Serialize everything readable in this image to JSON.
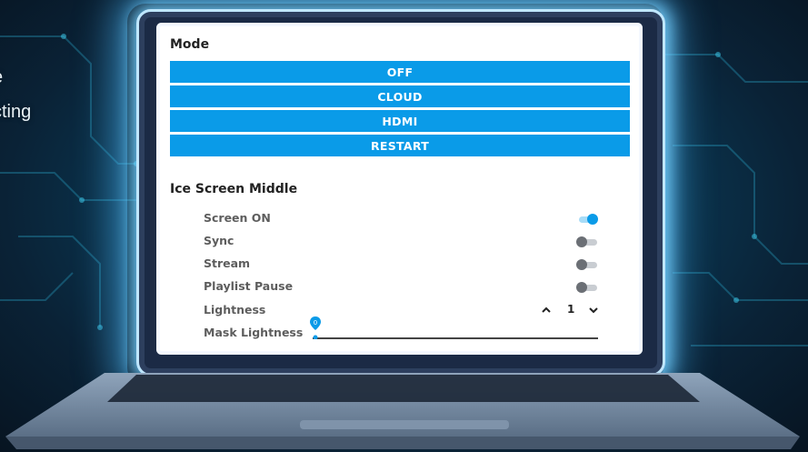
{
  "background_text": {
    "line1": "e",
    "line2": "cting"
  },
  "colors": {
    "accent": "#0a9be8",
    "screen_bg": "#ffffff",
    "glow": "#5ec8ff"
  },
  "mode": {
    "title": "Mode",
    "buttons": [
      "OFF",
      "CLOUD",
      "HDMI",
      "RESTART"
    ]
  },
  "ice_screen": {
    "title": "Ice Screen Middle",
    "rows": [
      {
        "label": "Screen ON",
        "control": "toggle",
        "on": true
      },
      {
        "label": "Sync",
        "control": "toggle",
        "on": false
      },
      {
        "label": "Stream",
        "control": "toggle",
        "on": false
      },
      {
        "label": "Playlist Pause",
        "control": "toggle",
        "on": false
      }
    ],
    "lightness": {
      "label": "Lightness",
      "up_icon": "chevron-up-icon",
      "value": "1",
      "down_icon": "chevron-down-icon"
    },
    "mask_lightness": {
      "label": "Mask Lightness",
      "value": "0",
      "level": 0
    }
  }
}
